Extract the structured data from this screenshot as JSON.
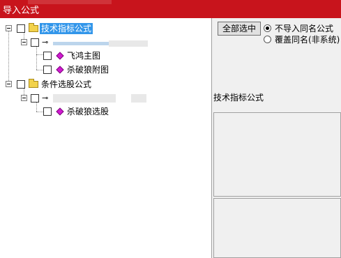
{
  "window": {
    "title": "导入公式"
  },
  "tree": {
    "root1": {
      "label": "技术指标公式"
    },
    "root1_children": [
      {
        "label": "飞鸿主图"
      },
      {
        "label": "杀破狼附图"
      }
    ],
    "root2": {
      "label": "条件选股公式"
    },
    "root2_children": [
      {
        "label": "杀破狼选股"
      }
    ]
  },
  "options": {
    "select_all_button": "全部选中",
    "radio_skip": "不导入同名公式",
    "radio_overwrite": "覆盖同名(非系统)",
    "selected": "radio_skip"
  },
  "right_panel": {
    "section_title": "技术指标公式"
  }
}
